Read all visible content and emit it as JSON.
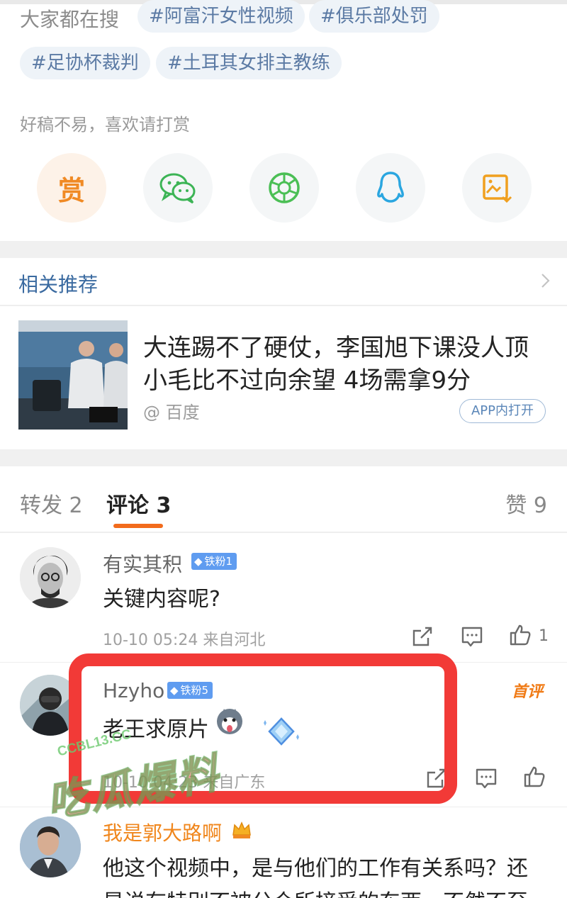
{
  "hot_search": {
    "label": "大家都在搜",
    "tags": [
      "#阿富汗女性视频",
      "#俱乐部处罚",
      "#足协杯裁判",
      "#土耳其女排主教练"
    ]
  },
  "reward": {
    "note": "好稿不易，喜欢请打赏",
    "reward_char": "赏"
  },
  "share_icons": [
    "reward-icon",
    "wechat-icon",
    "moments-icon",
    "qq-icon",
    "save-image-icon"
  ],
  "related": {
    "title": "相关推荐",
    "headline": "大连踢不了硬仗，李国旭下课没人顶 小毛比不过向余望 4场需拿9分",
    "source": "@ 百度",
    "open_app": "APP内打开"
  },
  "tabs": {
    "repost": "转发 2",
    "comments": "评论 3",
    "likes": "赞 9"
  },
  "comments": [
    {
      "name": "有实其积",
      "badge": "铁粉1",
      "text": "关键内容呢?",
      "meta": "10-10 05:24  来自河北",
      "likes": "1"
    },
    {
      "name": "Hzyho",
      "badge": "铁粉5",
      "text": "老王求原片",
      "meta": "10-10 04:23  来自广东",
      "tag": "首评",
      "likes": ""
    },
    {
      "name": "我是郭大路啊",
      "text_line1": "他这个视频中，是与他们的工作有关系吗？还",
      "text_line2": "是说有特别不被公众所接受的东西，不然不至"
    }
  ],
  "watermark": {
    "small": "CCBL13.CC",
    "big": "吃瓜爆料"
  },
  "colors": {
    "accent_orange": "#f26b1c",
    "highlight_red": "#f23a37",
    "link_blue": "#3a6aa0",
    "tag_bg": "#eef3f8"
  }
}
